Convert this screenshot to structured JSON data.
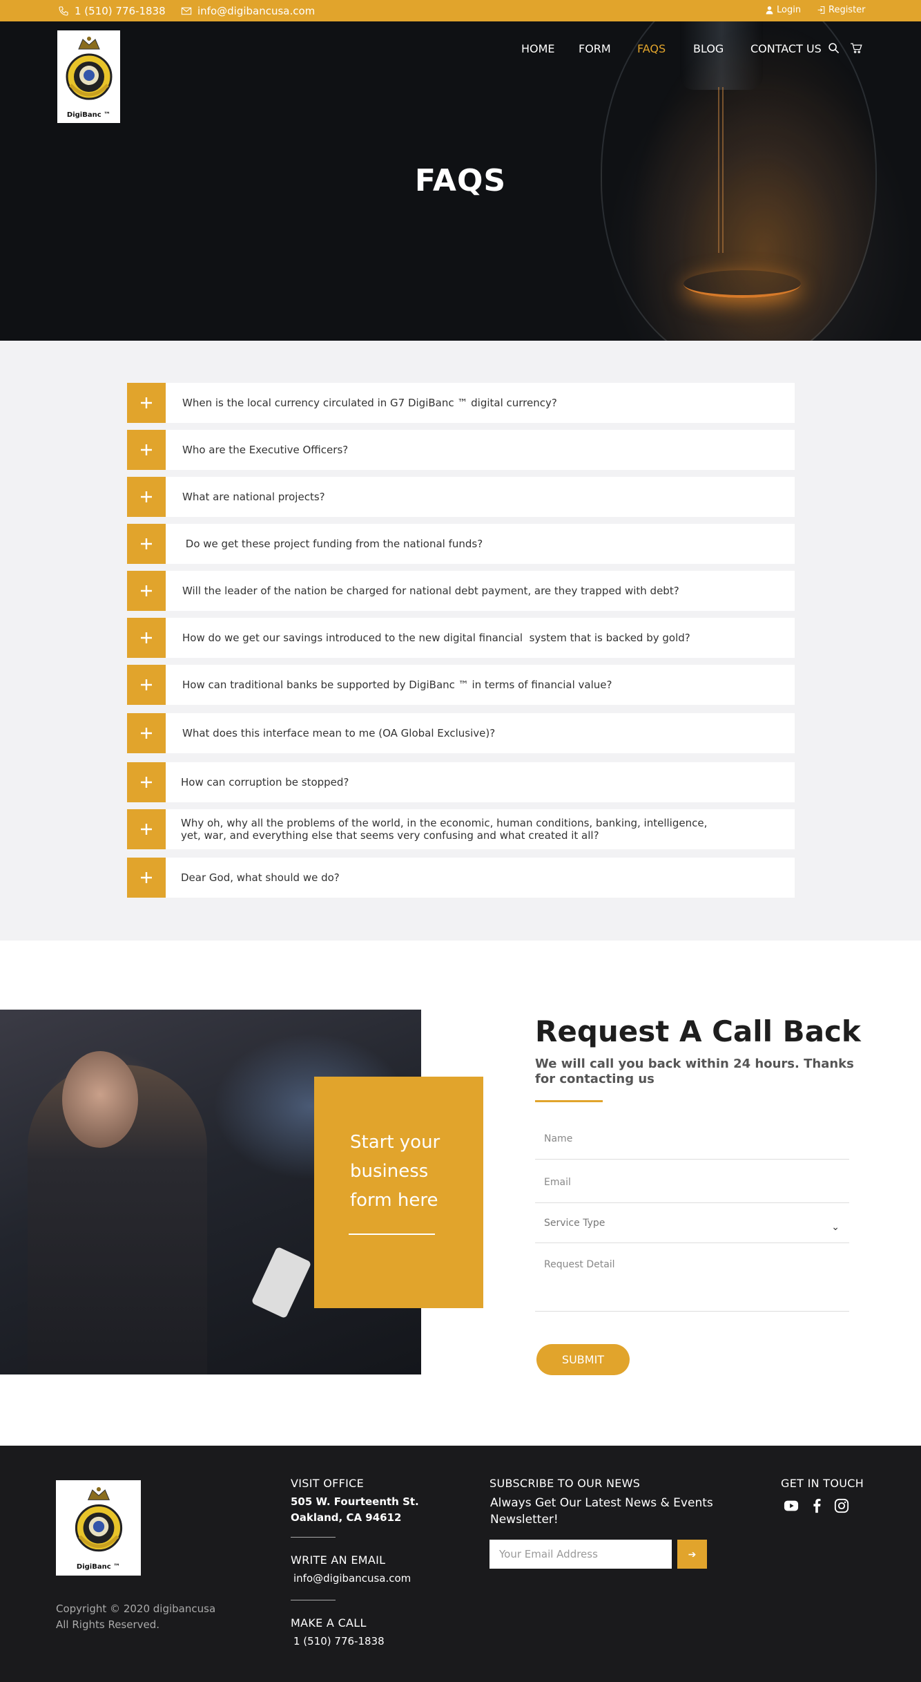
{
  "topbar": {
    "phone": "1 (510) 776-1838",
    "email": "info@digibancusa.com",
    "login": "Login",
    "register": "Register"
  },
  "logo": {
    "text": "DigiBanc ™"
  },
  "nav": {
    "items": [
      "HOME",
      "FORM",
      "FAQS",
      "BLOG",
      "CONTACT US"
    ],
    "active": "FAQS"
  },
  "hero": {
    "title": "FAQS"
  },
  "faq": {
    "questions": [
      "When is the local currency circulated in G7 DigiBanc ™ digital currency?",
      "Who are the Executive Officers?",
      "What are national projects?",
      " Do we get these project funding from the national funds?",
      "Will the leader of the nation be charged for national debt payment, are they trapped with debt?",
      "How do we get our savings introduced to the new digital financial  system that is backed by gold?",
      "How can traditional banks be supported by DigiBanc ™ in terms of financial value?",
      "What does this interface mean to me (OA Global Exclusive)?",
      "How can corruption be stopped?",
      "Why oh, why all the problems of the world, in the economic, human conditions, banking, intelligence, yet, war, and everything else that seems very confusing and what created it all?",
      "Dear God, what should we do?"
    ]
  },
  "callback": {
    "box_text": "Start your business form here",
    "title": "Request A Call Back",
    "subtitle": "We will call you back within 24 hours. Thanks for contacting us",
    "name_placeholder": "Name",
    "email_placeholder": "Email",
    "service_placeholder": "Service Type",
    "detail_placeholder": "Request Detail",
    "submit": "SUBMIT"
  },
  "footer": {
    "logo_text": "DigiBanc ™",
    "visit_title": "VISIT OFFICE",
    "address_line1": "505 W. Fourteenth St.",
    "address_line2": "Oakland, CA 94612",
    "email_title": "WRITE AN EMAIL",
    "email": "info@digibancusa.com",
    "call_title": "MAKE A CALL",
    "phone": "1 (510) 776-1838",
    "subscribe_title": "SUBSCRIBE TO OUR NEWS",
    "subscribe_text": "Always Get Our Latest News & Events Newsletter!",
    "subscribe_placeholder": "Your Email Address",
    "touch_title": "GET IN TOUCH",
    "copyright_line1": "Copyright © 2020 digibancusa",
    "copyright_line2": "All Rights Reserved.",
    "social": [
      "youtube-icon",
      "facebook-icon",
      "instagram-icon"
    ]
  },
  "colors": {
    "accent": "#e1a42c",
    "footer_bg": "#1a1a1c",
    "faq_bg": "#f2f2f4"
  }
}
